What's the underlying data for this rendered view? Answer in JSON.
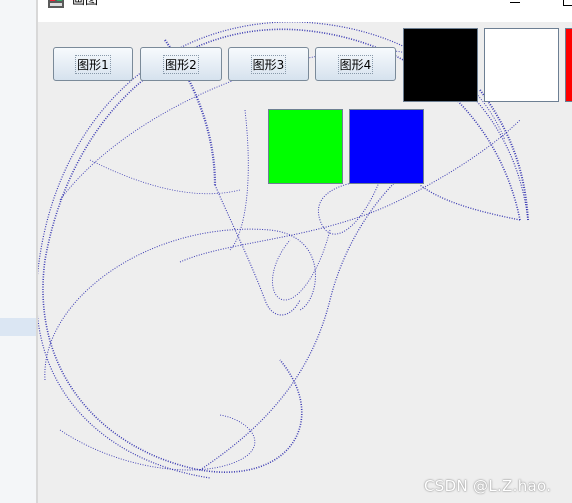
{
  "window": {
    "title": "画图",
    "icon": "paint-app-icon"
  },
  "toolbar": {
    "buttons": [
      {
        "label": "图形1"
      },
      {
        "label": "图形2"
      },
      {
        "label": "图形3"
      },
      {
        "label": "图形4"
      }
    ]
  },
  "palette": {
    "colors": [
      "#000000",
      "#ffffff",
      "#ff0000",
      "#00ff00",
      "#0000ff"
    ]
  },
  "drawing": {
    "stroke_color": "#1a1aa8"
  },
  "watermark": "CSDN @L.Z.hao."
}
